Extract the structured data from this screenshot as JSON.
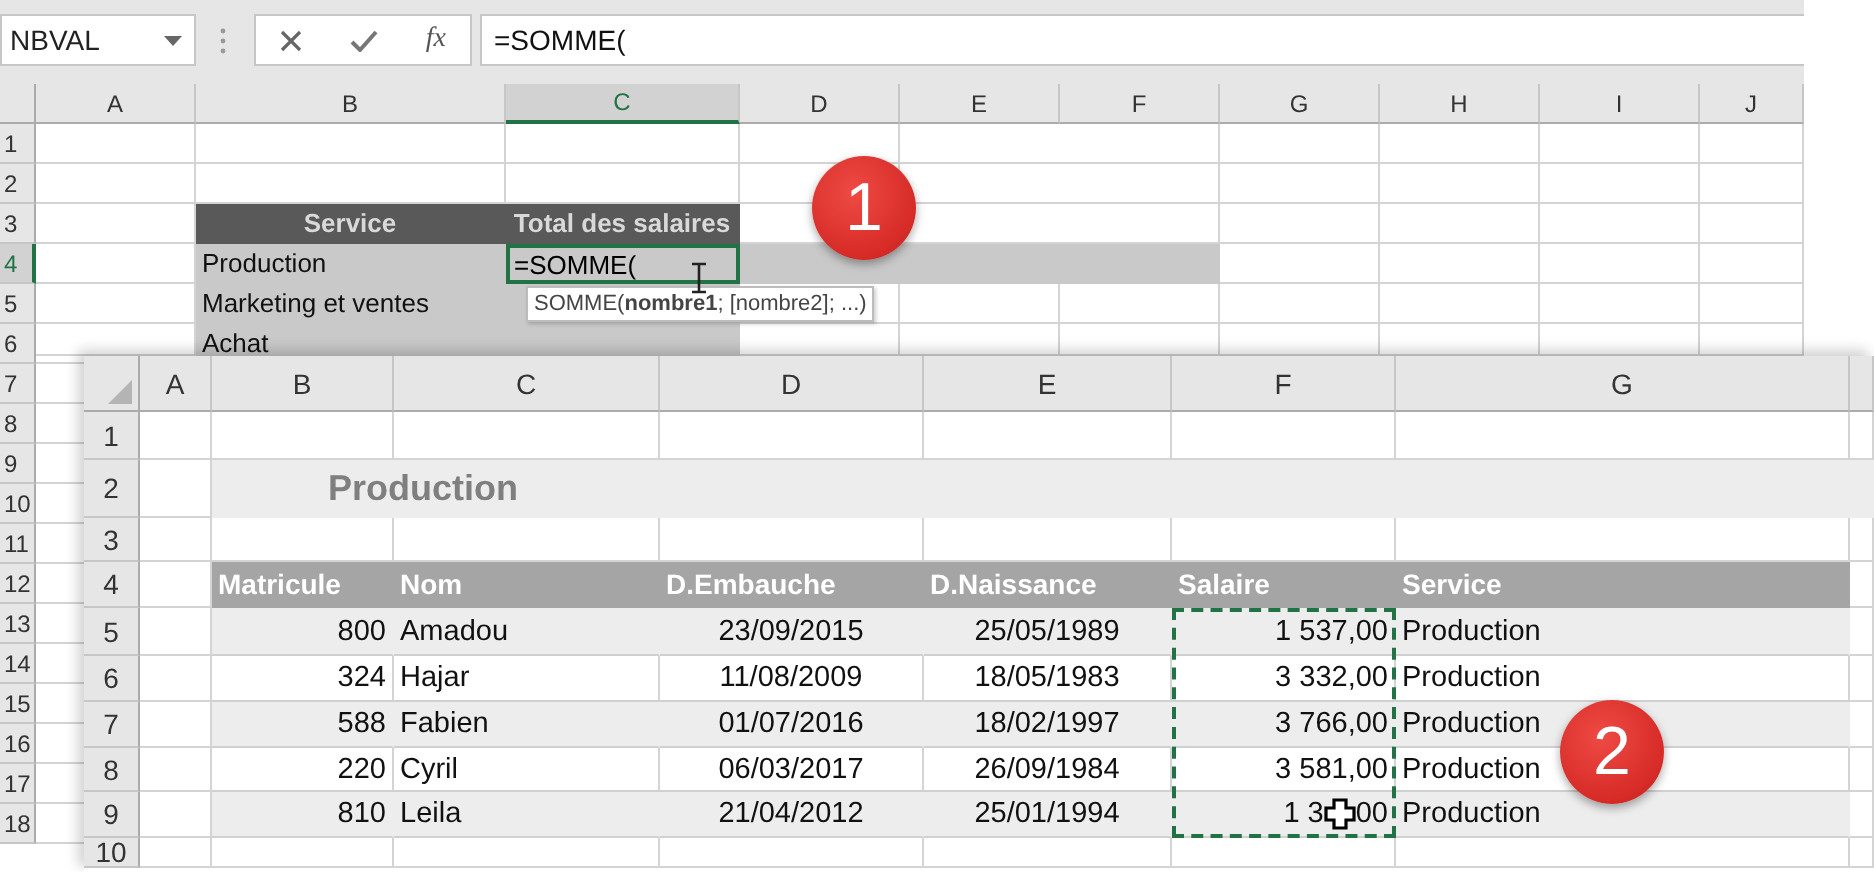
{
  "formula_bar": {
    "name_box": "NBVAL",
    "fx_label": "fx",
    "formula": "=SOMME("
  },
  "back_sheet": {
    "columns": [
      {
        "label": "A",
        "selected": false
      },
      {
        "label": "B",
        "selected": false
      },
      {
        "label": "C",
        "selected": true
      },
      {
        "label": "D",
        "selected": false
      },
      {
        "label": "E",
        "selected": false
      },
      {
        "label": "F",
        "selected": false
      },
      {
        "label": "G",
        "selected": false
      },
      {
        "label": "H",
        "selected": false
      },
      {
        "label": "I",
        "selected": false
      },
      {
        "label": "J",
        "selected": false
      }
    ],
    "rows": [
      {
        "number": "1",
        "selected": false
      },
      {
        "number": "2",
        "selected": false
      },
      {
        "number": "3",
        "selected": false
      },
      {
        "number": "4",
        "selected": true
      },
      {
        "number": "5",
        "selected": false
      },
      {
        "number": "6",
        "selected": false
      },
      {
        "number": "7",
        "selected": false
      },
      {
        "number": "8",
        "selected": false
      },
      {
        "number": "9",
        "selected": false
      },
      {
        "number": "10",
        "selected": false
      },
      {
        "number": "11",
        "selected": false
      },
      {
        "number": "12",
        "selected": false
      },
      {
        "number": "13",
        "selected": false
      },
      {
        "number": "14",
        "selected": false
      },
      {
        "number": "15",
        "selected": false
      },
      {
        "number": "16",
        "selected": false
      },
      {
        "number": "17",
        "selected": false
      },
      {
        "number": "18",
        "selected": false
      }
    ],
    "summary_table": {
      "headers": [
        "Service",
        "Total des salaires"
      ],
      "rows": [
        {
          "service": "Production",
          "total": "=SOMME("
        },
        {
          "service": "Marketing et ventes"
        },
        {
          "service": "Achat"
        }
      ]
    },
    "tooltip": "SOMME(**nombre1**; [nombre2]; ...)"
  },
  "front_sheet": {
    "columns": [
      "A",
      "B",
      "C",
      "D",
      "E",
      "F",
      "G"
    ],
    "rows": [
      "1",
      "2",
      "3",
      "4",
      "5",
      "6",
      "7",
      "8",
      "9",
      "10"
    ],
    "title": "Production",
    "headers": [
      "Matricule",
      "Nom",
      "D.Embauche",
      "D.Naissance",
      "Salaire",
      "Service"
    ],
    "records": [
      {
        "matricule": "800",
        "nom": "Amadou",
        "embauche": "23/09/2015",
        "naissance": "25/05/1989",
        "salaire": "1 537,00",
        "service": "Production"
      },
      {
        "matricule": "324",
        "nom": "Hajar",
        "embauche": "11/08/2009",
        "naissance": "18/05/1983",
        "salaire": "3 332,00",
        "service": "Production"
      },
      {
        "matricule": "588",
        "nom": "Fabien",
        "embauche": "01/07/2016",
        "naissance": "18/02/1997",
        "salaire": "3 766,00",
        "service": "Production"
      },
      {
        "matricule": "220",
        "nom": "Cyril",
        "embauche": "06/03/2017",
        "naissance": "26/09/1984",
        "salaire": "3 581,00",
        "service": "Production"
      },
      {
        "matricule": "810",
        "nom": "Leila",
        "embauche": "21/04/2012",
        "naissance": "25/01/1994",
        "salaire": "1 3",
        "salaire_after_cursor": "00",
        "service": "Production"
      }
    ]
  },
  "badges": [
    {
      "label": "1"
    },
    {
      "label": "2"
    }
  ]
}
